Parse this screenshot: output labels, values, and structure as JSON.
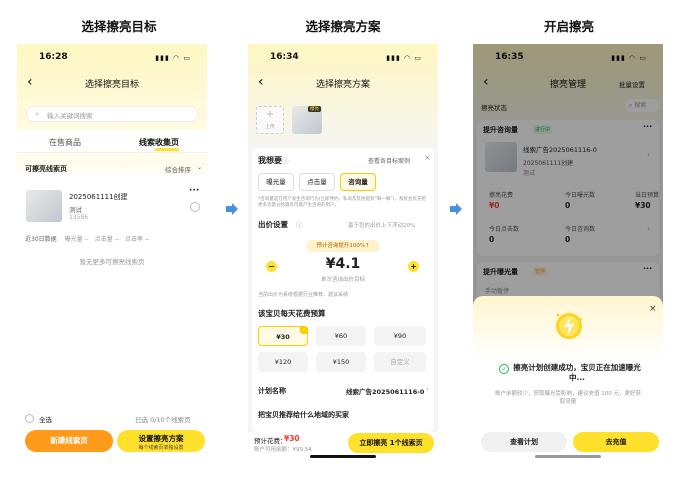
{
  "captions": [
    "选择擦亮目标",
    "选择擦亮方案",
    "开启擦亮"
  ],
  "p1": {
    "time": "16:28",
    "title": "选择擦亮目标",
    "search_placeholder": "输入关键词搜索",
    "tabs": [
      "在售商品",
      "线索收集页"
    ],
    "section_label": "可擦亮线索页",
    "sort": "综合排序",
    "item": {
      "name": "2025061111创建",
      "sub": "测试",
      "id": "13586"
    },
    "stats": [
      "近30日数据",
      "曝光量",
      "点击量",
      "点击率"
    ],
    "stat_dash": "--",
    "empty_hint": "暂无更多可擦亮线索页",
    "select_all": "全选",
    "selected_count": "已选 0/10个线索页",
    "btn_new": "新建线索页",
    "btn_setup": "设置擦亮方案",
    "btn_setup_sub": "每个线索页单独设置"
  },
  "p2": {
    "time": "16:34",
    "title": "选择擦亮方案",
    "upload": "上传",
    "thumb_badge": "擦亮",
    "want_label": "我想要",
    "view_example": "查看各目标案例",
    "goals": [
      "曝光量",
      "点击量",
      "咨询量"
    ],
    "goal_note": "*咨询量是在用户发生咨询行为(立即预约、私询及其他提到“聊一聊”)，系统会优先把更多流量分给最有可能产生咨询的用户。",
    "bid_label": "出价设置",
    "bid_hint": "基于您的出价上下浮动20%",
    "predict": "预计咨询提升100%↑",
    "bid_value": "¥4.1",
    "bid_unit": "单次咨询出价目标",
    "bid_note": "当前出价为系统根据行业推荐，建议采纳",
    "budget_label": "该宝贝每天花费预算",
    "prices": [
      "¥30",
      "¥60",
      "¥90",
      "¥120",
      "¥150",
      "自定义"
    ],
    "plan_label": "计划名称",
    "plan_value": "线索广告2025061116-0",
    "region_label": "把宝贝推荐给什么地域的买家",
    "est_label": "预计花费：",
    "est_value": "¥30",
    "balance": "账户可用余额：¥99.54",
    "submit": "立即擦亮 1个线索页"
  },
  "p3": {
    "time": "16:35",
    "title": "擦亮管理",
    "batch": "批量设置",
    "status_filter": "擦亮状态",
    "search": "搜索",
    "card1_title": "提升咨询量",
    "card1_badge": "进行中",
    "card1_name": "线索广告2025061116-0",
    "card1_item": "2025061111创建",
    "card1_sub": "测试",
    "stats_top": [
      [
        "擦亮花费",
        "¥0"
      ],
      [
        "今日曝光数",
        "0"
      ],
      [
        "当日预算",
        "¥30"
      ]
    ],
    "stats_bottom": [
      [
        "今日点击数",
        "0"
      ],
      [
        "今日咨询数",
        "0"
      ]
    ],
    "card2_title": "提升曝光量",
    "card2_badge": "暂停",
    "card2_sub": "手动暂停",
    "success_title": "擦亮计划创建成功，宝贝正在加速曝光中...",
    "success_note": "账户余额较少，获取曝光受影响，建议充值 100 元，更好获取流量",
    "btn_view": "查看计划",
    "btn_recharge": "去充值"
  },
  "colors": {
    "brand_yellow": "#ffe02a",
    "orange": "#ff9a1a",
    "red": "#ff3b30",
    "success_green": "#1db954",
    "arrow_blue": "#4a90e2"
  }
}
